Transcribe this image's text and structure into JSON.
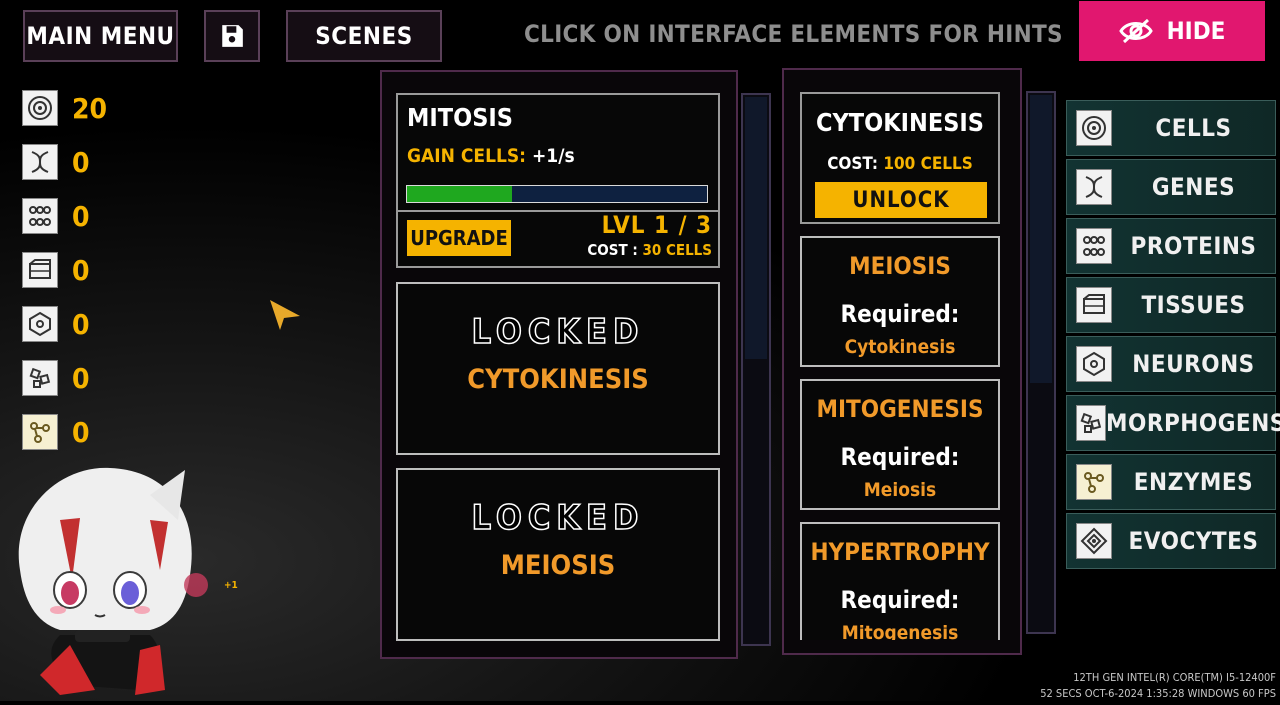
{
  "top_bar": {
    "main_menu_label": "MAIN MENU",
    "save_icon": "floppy-disk-icon",
    "scenes_label": "SCENES",
    "hint": "CLICK ON INTERFACE ELEMENTS FOR HINTS",
    "hide_label": "HIDE",
    "hide_icon": "eye-slash-icon"
  },
  "resources": [
    {
      "icon": "cell-icon",
      "value": "20"
    },
    {
      "icon": "dna-icon",
      "value": "0"
    },
    {
      "icon": "protein-icon",
      "value": "0"
    },
    {
      "icon": "tissue-icon",
      "value": "0"
    },
    {
      "icon": "neuron-icon",
      "value": "0"
    },
    {
      "icon": "morphogen-icon",
      "value": "0"
    },
    {
      "icon": "enzyme-icon",
      "value": "0"
    }
  ],
  "upgrades": {
    "mitosis": {
      "title": "MITOSIS",
      "gain_label": "GAIN CELLS:",
      "gain_value": "+1/s",
      "progress": 0.35,
      "upgrade_label": "UPGRADE",
      "level": "LVL 1 / 3",
      "cost_label": "COST :",
      "cost_value": "30 CELLS"
    },
    "locked": [
      {
        "label": "LOCKED",
        "name": "CYTOKINESIS"
      },
      {
        "label": "LOCKED",
        "name": "MEIOSIS"
      }
    ]
  },
  "unlocks": {
    "cytokinesis": {
      "title": "CYTOKINESIS",
      "cost_label": "COST:",
      "cost_value": "100 CELLS",
      "unlock_label": "UNLOCK"
    },
    "items": [
      {
        "title": "MEIOSIS",
        "required_label": "Required:",
        "required": "Cytokinesis"
      },
      {
        "title": "MITOGENESIS",
        "required_label": "Required:",
        "required": "Meiosis"
      },
      {
        "title": "HYPERTROPHY",
        "required_label": "Required:",
        "required": "Mitogenesis"
      }
    ]
  },
  "categories": [
    {
      "label": "CELLS",
      "icon": "cell-icon"
    },
    {
      "label": "GENES",
      "icon": "dna-icon"
    },
    {
      "label": "PROTEINS",
      "icon": "protein-icon"
    },
    {
      "label": "TISSUES",
      "icon": "tissue-icon"
    },
    {
      "label": "NEURONS",
      "icon": "neuron-icon"
    },
    {
      "label": "MORPHOGENS",
      "icon": "morphogen-icon"
    },
    {
      "label": "ENZYMES",
      "icon": "enzyme-icon"
    },
    {
      "label": "EVOCYTES",
      "icon": "evocyte-icon"
    }
  ],
  "overlay": {
    "plus_one": "+1"
  },
  "system": {
    "cpu": "12TH GEN INTEL(R) CORE(TM) I5-12400F",
    "stats": "52 SECS  OCT-6-2024 1:35:28  WINDOWS  60 FPS"
  },
  "colors": {
    "accent_pink": "#e1176f",
    "gold": "#f5b300",
    "orange": "#f19a2a",
    "progress_green": "#1fa81f",
    "panel_border": "#4f2a4b",
    "category_teal": "#123332"
  }
}
